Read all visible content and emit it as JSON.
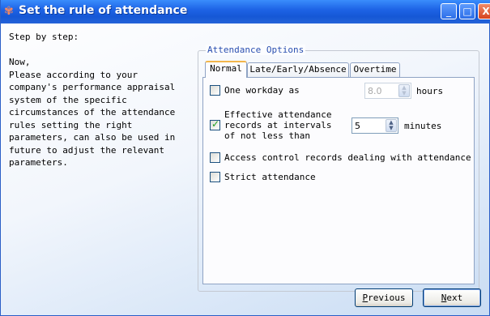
{
  "window": {
    "title": "Set the rule of attendance",
    "controls": {
      "minimize": "_",
      "maximize": "□",
      "close": "X"
    }
  },
  "help": {
    "heading": "Step by step:",
    "body": "Now,\nPlease according to your company's performance appraisal system of the specific circumstances of the attendance rules setting the right parameters, can also be used in future to adjust the relevant parameters."
  },
  "options": {
    "group_label": "Attendance Options",
    "tabs": [
      {
        "label": "Normal",
        "active": true
      },
      {
        "label": "Late/Early/Absence",
        "active": false
      },
      {
        "label": "Overtime",
        "active": false
      }
    ],
    "workday": {
      "label": "One workday as",
      "checked": false,
      "value": "8.0",
      "unit": "hours",
      "enabled": false
    },
    "effective": {
      "label": "Effective attendance\nrecords at intervals\nof not less than",
      "checked": true,
      "value": "5",
      "unit": "minutes"
    },
    "access_control": {
      "label": "Access control records dealing with attendance",
      "checked": false
    },
    "strict": {
      "label": "Strict attendance",
      "checked": false
    }
  },
  "buttons": {
    "previous": "Previous",
    "previous_accel": "P",
    "next": "Next",
    "next_accel": "N"
  },
  "icons": {
    "title": "app-logo-icon",
    "checkmark": "checkmark-icon",
    "spin": "spin-arrows-icon"
  }
}
